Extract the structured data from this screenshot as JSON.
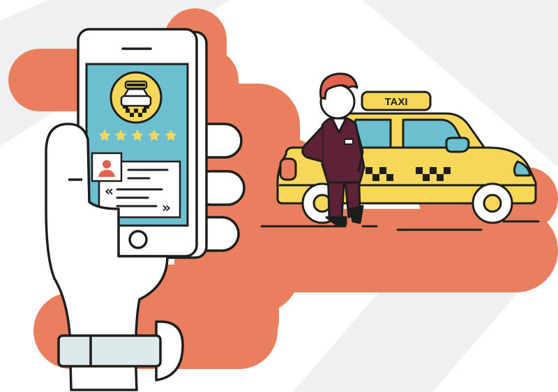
{
  "taxi": {
    "roof_sign_label": "TAXI"
  },
  "app_screen": {
    "rating_stars": 5,
    "open_quote": "«",
    "close_quote": "»"
  },
  "colors": {
    "background_blob": "#ea7f5f",
    "background_stripe": "#eef0f1",
    "taxi_yellow": "#f7d75a",
    "screen_blue": "#6cbfcf",
    "driver_suit": "#5e2238",
    "driver_hair": "#e2624e",
    "outline": "#1d1d1b",
    "phone_body": "#ffffff",
    "wristband": "#dde9ea"
  },
  "icons": [
    "taxi-icon",
    "star-icon",
    "user-avatar-icon",
    "chevron-double-left-icon",
    "chevron-double-right-icon"
  ]
}
